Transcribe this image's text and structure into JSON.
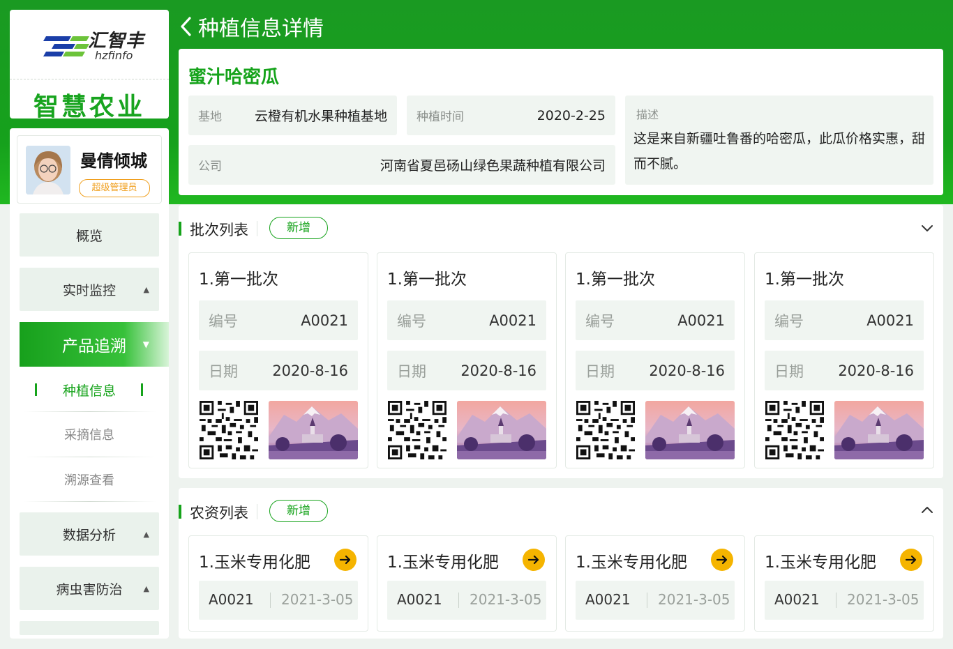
{
  "brand": {
    "name": "汇智丰",
    "sub": "hzfinfo",
    "app_title": "智慧农业"
  },
  "user": {
    "name": "曼倩倾城",
    "role": "超级管理员"
  },
  "nav": {
    "overview": "概览",
    "monitor": "实时监控",
    "trace": "产品追溯",
    "sub_planting": "种植信息",
    "sub_picking": "采摘信息",
    "sub_trace_view": "溯源查看",
    "analysis": "数据分析",
    "pest": "病虫害防治"
  },
  "header": {
    "title": "种植信息详情"
  },
  "info": {
    "product": "蜜汁哈密瓜",
    "base_label": "基地",
    "base_value": "云橙有机水果种植基地",
    "time_label": "种植时间",
    "time_value": "2020-2-25",
    "company_label": "公司",
    "company_value": "河南省夏邑砀山绿色果蔬种植有限公司",
    "desc_label": "描述",
    "desc_text": "这是来自新疆吐鲁番的哈密瓜，此瓜价格实惠，甜而不腻。"
  },
  "batches": {
    "title": "批次列表",
    "add_label": "新增",
    "items": [
      {
        "name": "1.第一批次",
        "code_label": "编号",
        "code": "A0021",
        "date_label": "日期",
        "date": "2020-8-16"
      },
      {
        "name": "1.第一批次",
        "code_label": "编号",
        "code": "A0021",
        "date_label": "日期",
        "date": "2020-8-16"
      },
      {
        "name": "1.第一批次",
        "code_label": "编号",
        "code": "A0021",
        "date_label": "日期",
        "date": "2020-8-16"
      },
      {
        "name": "1.第一批次",
        "code_label": "编号",
        "code": "A0021",
        "date_label": "日期",
        "date": "2020-8-16"
      }
    ]
  },
  "materials": {
    "title": "农资列表",
    "add_label": "新增",
    "items": [
      {
        "name": "1.玉米专用化肥",
        "code": "A0021",
        "date": "2021-3-05"
      },
      {
        "name": "1.玉米专用化肥",
        "code": "A0021",
        "date": "2021-3-05"
      },
      {
        "name": "1.玉米专用化肥",
        "code": "A0021",
        "date": "2021-3-05"
      },
      {
        "name": "1.玉米专用化肥",
        "code": "A0021",
        "date": "2021-3-05"
      }
    ]
  },
  "colors": {
    "primary": "#16a31b",
    "accent": "#f5b400",
    "panel": "#f0f5f1"
  }
}
